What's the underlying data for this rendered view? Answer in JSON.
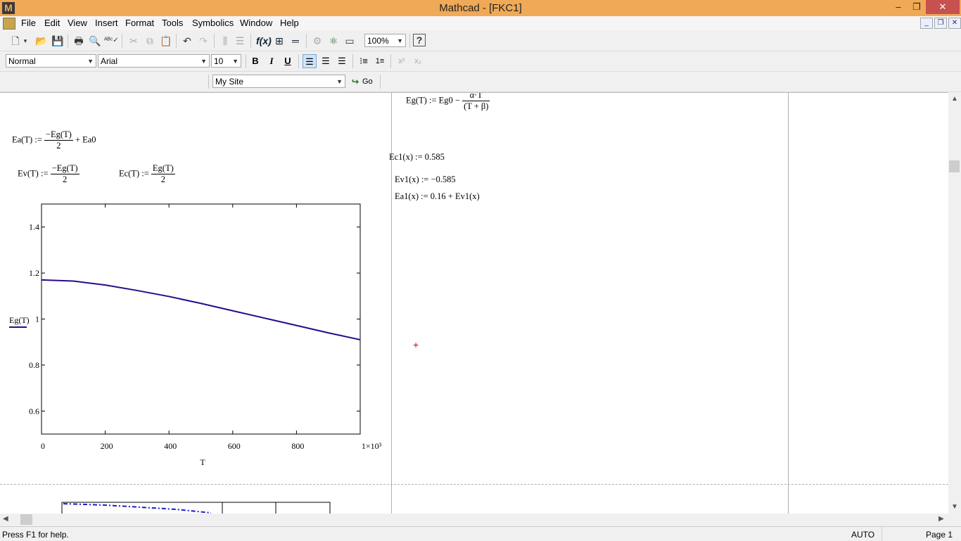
{
  "window": {
    "title": "Mathcad - [FKC1]",
    "logo": "M",
    "min": "–",
    "max": "❐",
    "close": "✕"
  },
  "menu": [
    "File",
    "Edit",
    "View",
    "Insert",
    "Format",
    "Tools",
    "Symbolics",
    "Window",
    "Help"
  ],
  "toolbar": {
    "zoom": "100%"
  },
  "format": {
    "style": "Normal",
    "font": "Arial",
    "size": "10"
  },
  "resources": {
    "site": "My Site",
    "go": "Go"
  },
  "equations": {
    "ea": {
      "lhs": "Ea(T) :=",
      "num": "−Eg(T)",
      "den": "2",
      "tail": "+ Ea0"
    },
    "ev": {
      "lhs": "Ev(T) :=",
      "num": "−Eg(T)",
      "den": "2"
    },
    "ec": {
      "lhs": "Ec(T) :=",
      "num": "Eg(T)",
      "den": "2"
    },
    "eg": {
      "lhs": "Eg(T) := Eg0 −",
      "num": "α·T",
      "den": "(T + β)"
    },
    "ec1": "Ec1(x) := 0.585",
    "ev1": "Ev1(x) := −0.585",
    "ea1": "Ea1(x) := 0.16 + Ev1(x)"
  },
  "chart_data": {
    "type": "line",
    "xlabel": "T",
    "ylabel": "Eg(T)",
    "xlim": [
      0,
      1000
    ],
    "ylim": [
      0.5,
      1.5
    ],
    "x_ticks": [
      "0",
      "200",
      "400",
      "600",
      "800",
      "1×10³"
    ],
    "x_tick_values": [
      0,
      200,
      400,
      600,
      800,
      1000
    ],
    "y_ticks": [
      "0.6",
      "0.8",
      "1",
      "1.2",
      "1.4"
    ],
    "y_tick_values": [
      0.6,
      0.8,
      1.0,
      1.2,
      1.4
    ],
    "series": [
      {
        "color": "#2a0a8a",
        "x": [
          0,
          100,
          200,
          300,
          400,
          500,
          600,
          700,
          800,
          900,
          1000
        ],
        "y": [
          1.17,
          1.165,
          1.148,
          1.124,
          1.098,
          1.068,
          1.036,
          1.004,
          0.972,
          0.94,
          0.91
        ]
      }
    ]
  },
  "status": {
    "help": "Press F1 for help.",
    "mode": "AUTO",
    "page": "Page 1"
  }
}
